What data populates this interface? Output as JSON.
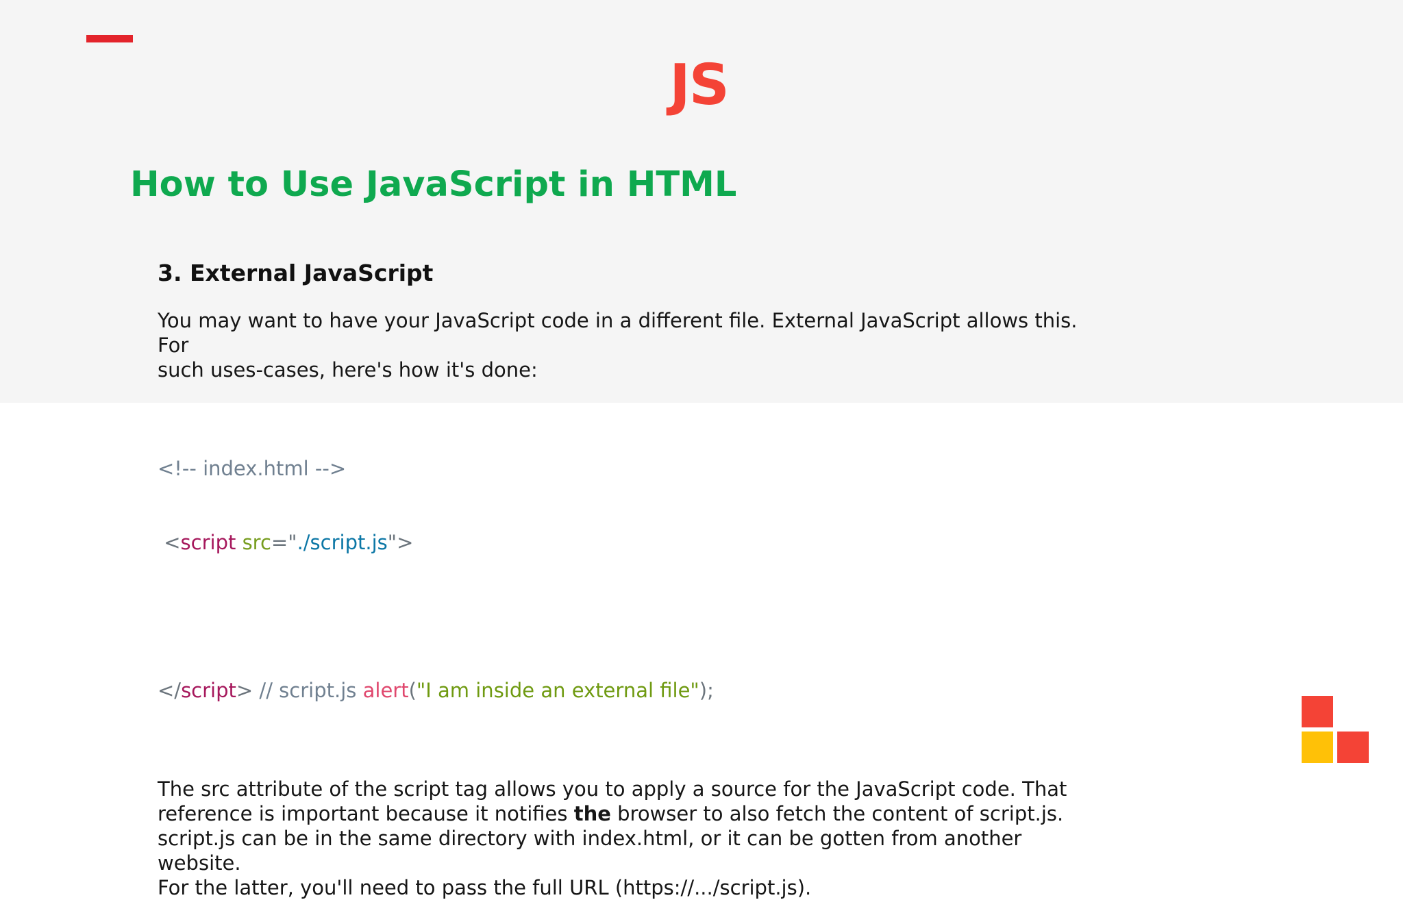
{
  "colors": {
    "top_band": "#f5f5f5",
    "accent_dash": "#e3242b",
    "logo": "#f44336",
    "title": "#0fa94f",
    "code_punctuation": "#6c757d",
    "code_comment": "#708090",
    "code_tag": "#a6185c",
    "code_attribute": "#779d1f",
    "code_string_value": "#0c77a6",
    "code_function": "#e0486e",
    "code_string": "#6f9a11",
    "corner_red": "#f44336",
    "corner_yellow": "#ffc107"
  },
  "slide": {
    "logo": "JS",
    "title": "How to Use JavaScript in HTML",
    "section_heading": "3. External JavaScript",
    "intro_line_1": "You may want to have your JavaScript code in a different file. External JavaScript allows this. For",
    "intro_line_2": "such uses-cases, here's how it's done:",
    "code": {
      "line1": "<!-- index.html -->",
      "line2": {
        "space": " ",
        "lt": "<",
        "tag": "script",
        "space2": " ",
        "attr": "src",
        "eq": "=",
        "quote_open": "\"",
        "value": "./script.js",
        "quote_close": "\"",
        "gt": ">"
      },
      "line3": {
        "close_lt": "</",
        "tag": "script",
        "gt": ">",
        "comment": " // script.js ",
        "func": "alert",
        "paren_open": "(",
        "string": "\"I am inside an external file\"",
        "paren_close": ");"
      }
    },
    "explain": {
      "line1": " The src attribute of the script tag allows you to apply a source for the JavaScript code. That",
      "line2_before": "reference is important because it notifies ",
      "line2_bold": "the",
      "line2_after": " browser to also fetch the content of script.js.",
      "line3": "script.js can be in the same directory with index.html, or it can be gotten from another website.",
      "line4": "For the latter, you'll need to pass the full URL (https://.../script.js)."
    }
  }
}
